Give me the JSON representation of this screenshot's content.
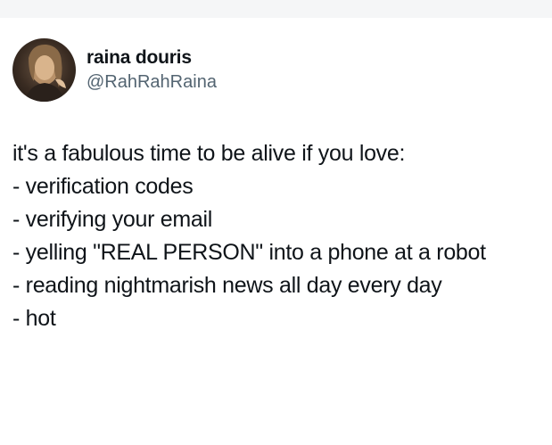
{
  "tweet": {
    "author": {
      "display_name": "raina douris",
      "handle": "@RahRahRaina",
      "avatar_icon": "profile-photo"
    },
    "lines": [
      "it's a fabulous time to be alive if you love:",
      "- verification codes",
      "- verifying your email",
      "- yelling \"REAL PERSON\" into a phone at a robot",
      "- reading nightmarish news all day every day",
      "- hot"
    ]
  }
}
